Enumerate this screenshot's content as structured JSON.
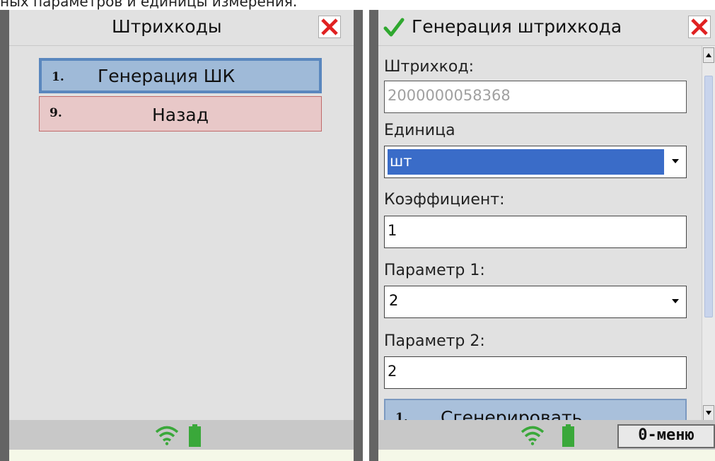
{
  "caption": "ных параметров и единицы измерения.",
  "left_screen": {
    "title": "Штрихкоды",
    "menu": [
      {
        "num": "1.",
        "label": "Генерация ШК"
      },
      {
        "num": "9.",
        "label": "Назад"
      }
    ]
  },
  "right_screen": {
    "title": "Генерация штрихкода",
    "fields": {
      "barcode_label": "Штрихкод:",
      "barcode_value": "2000000058368",
      "unit_label": "Единица",
      "unit_value": "шт",
      "coef_label": "Коэффициент:",
      "coef_value": "1",
      "param1_label": "Параметр 1:",
      "param1_value": "2",
      "param2_label": "Параметр 2:",
      "param2_value": "2"
    },
    "generate_button": {
      "num": "1.",
      "label": "Сгенерировать"
    },
    "menu_button": "0-меню"
  },
  "colors": {
    "accent_blue": "#5a87be",
    "back_red": "#c06a6a",
    "close_red": "#e02020",
    "wifi_green": "#3aa83a",
    "check_green": "#2fa82f"
  },
  "icons": [
    "close-icon",
    "checkmark-icon",
    "wifi-icon",
    "battery-icon",
    "scroll-up-icon",
    "scroll-down-icon",
    "dropdown-arrow-icon"
  ]
}
